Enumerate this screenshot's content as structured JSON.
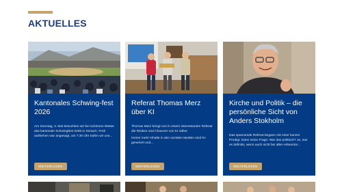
{
  "section": {
    "title": "AKTUELLES"
  },
  "cards": [
    {
      "title": "Kantonales Schwing-fest 2026",
      "paragraphs": [
        "Am Sonntag, 3. Mai besuchten wir bei schönem Wetter das kantonale Schwingfest 2026 in Sirnach. Früh aufstehen war angesagt, um 7:30 Uhr trafen wir uns..."
      ],
      "button": "WEITERLESEN"
    },
    {
      "title": "Referat Thomas Merz über KI",
      "paragraphs": [
        "Thomas Merz bringt uns in einem interessanten Referat die Risiken und Chancen von KI näher.",
        "Immer mehr Inhalte in den sozialen Medien sind KI-generiert und..."
      ],
      "button": "WEITERLESEN"
    },
    {
      "title": "Kirche und Politik – die persönliche Sicht von Anders Stokholm",
      "paragraphs": [
        "Das spannende Referat begann mit einer kurzen Predigt. Dann seine Frage: War das politisch? Ja, war es definitiv, wenn auch nicht bei allen erkenntor..."
      ],
      "button": "WEITERLESEN"
    }
  ],
  "colors": {
    "card_bg": "#033b84",
    "accent": "#c4a46b",
    "title": "#1d3d7c"
  }
}
